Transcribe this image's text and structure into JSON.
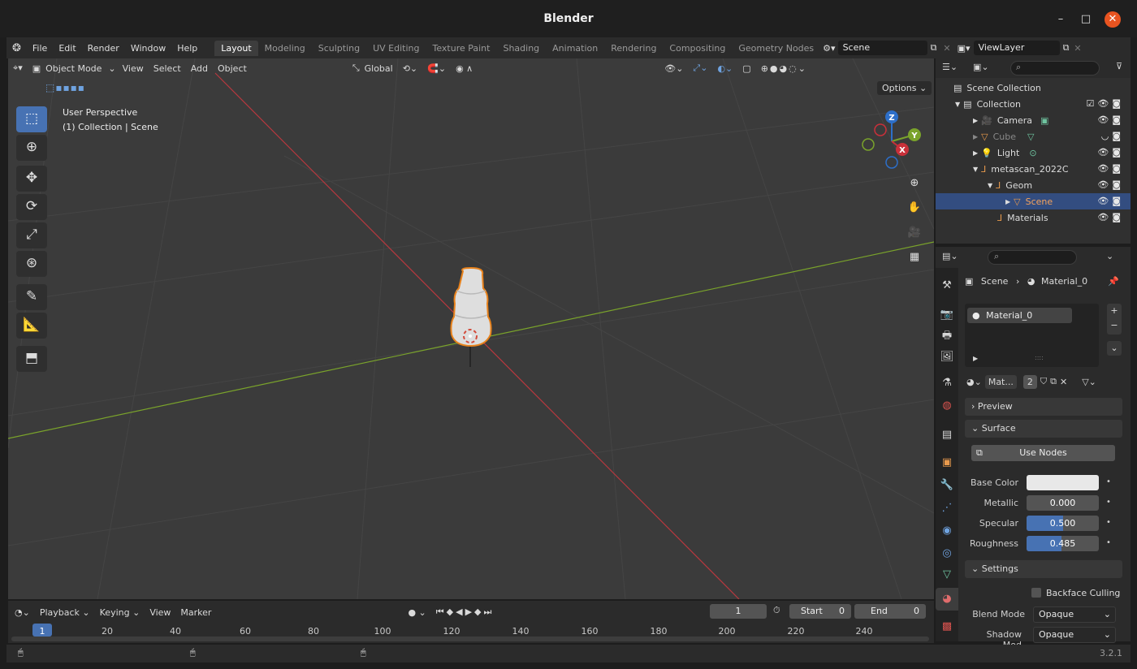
{
  "window": {
    "title": "Blender"
  },
  "menubar": {
    "menus": [
      "File",
      "Edit",
      "Render",
      "Window",
      "Help"
    ],
    "workspaces": [
      "Layout",
      "Modeling",
      "Sculpting",
      "UV Editing",
      "Texture Paint",
      "Shading",
      "Animation",
      "Rendering",
      "Compositing",
      "Geometry Nodes"
    ],
    "active_workspace": "Layout",
    "scene_name": "Scene",
    "view_layer": "ViewLayer"
  },
  "viewport": {
    "mode": "Object Mode",
    "menus": [
      "View",
      "Select",
      "Add",
      "Object"
    ],
    "transform_orientation": "Global",
    "options_label": "Options",
    "info_line1": "User Perspective",
    "info_line2": "(1) Collection | Scene",
    "gizmo_axes": [
      "Z",
      "Y",
      "X"
    ]
  },
  "outliner": {
    "search_placeholder": "",
    "root": "Scene Collection",
    "items": [
      {
        "label": "Collection"
      },
      {
        "label": "Camera"
      },
      {
        "label": "Cube"
      },
      {
        "label": "Light"
      },
      {
        "label": "metascan_2022C"
      },
      {
        "label": "Geom"
      },
      {
        "label": "Scene"
      },
      {
        "label": "Materials"
      }
    ]
  },
  "properties": {
    "breadcrumb_object": "Scene",
    "breadcrumb_material": "Material_0",
    "material_slot": "Material_0",
    "material_short": "Mat...",
    "material_users": "2",
    "panels": {
      "preview": "Preview",
      "surface": "Surface",
      "settings": "Settings"
    },
    "use_nodes_label": "Use Nodes",
    "fields": {
      "base_color_label": "Base Color",
      "metallic_label": "Metallic",
      "metallic_value": "0.000",
      "metallic_fraction": 0.0,
      "specular_label": "Specular",
      "specular_value": "0.500",
      "specular_fraction": 0.5,
      "roughness_label": "Roughness",
      "roughness_value": "0.485",
      "roughness_fraction": 0.485
    },
    "backface_culling_label": "Backface Culling",
    "blend_mode_label": "Blend Mode",
    "blend_mode_value": "Opaque",
    "shadow_mode_label": "Shadow Mod",
    "shadow_mode_value": "Opaque"
  },
  "timeline": {
    "menus": [
      "Playback",
      "Keying",
      "View",
      "Marker"
    ],
    "current_frame": "1",
    "start_label": "Start",
    "start_value": "0",
    "end_label": "End",
    "end_value": "0",
    "ticks": [
      "1",
      "20",
      "40",
      "60",
      "80",
      "100",
      "120",
      "140",
      "160",
      "180",
      "200",
      "220",
      "240"
    ]
  },
  "status": {
    "version": "3.2.1"
  },
  "colors": {
    "accent": "#4772b3",
    "selection_outline": "#e8821c",
    "x_axis": "#b8383e",
    "y_axis": "#7aa32b"
  }
}
